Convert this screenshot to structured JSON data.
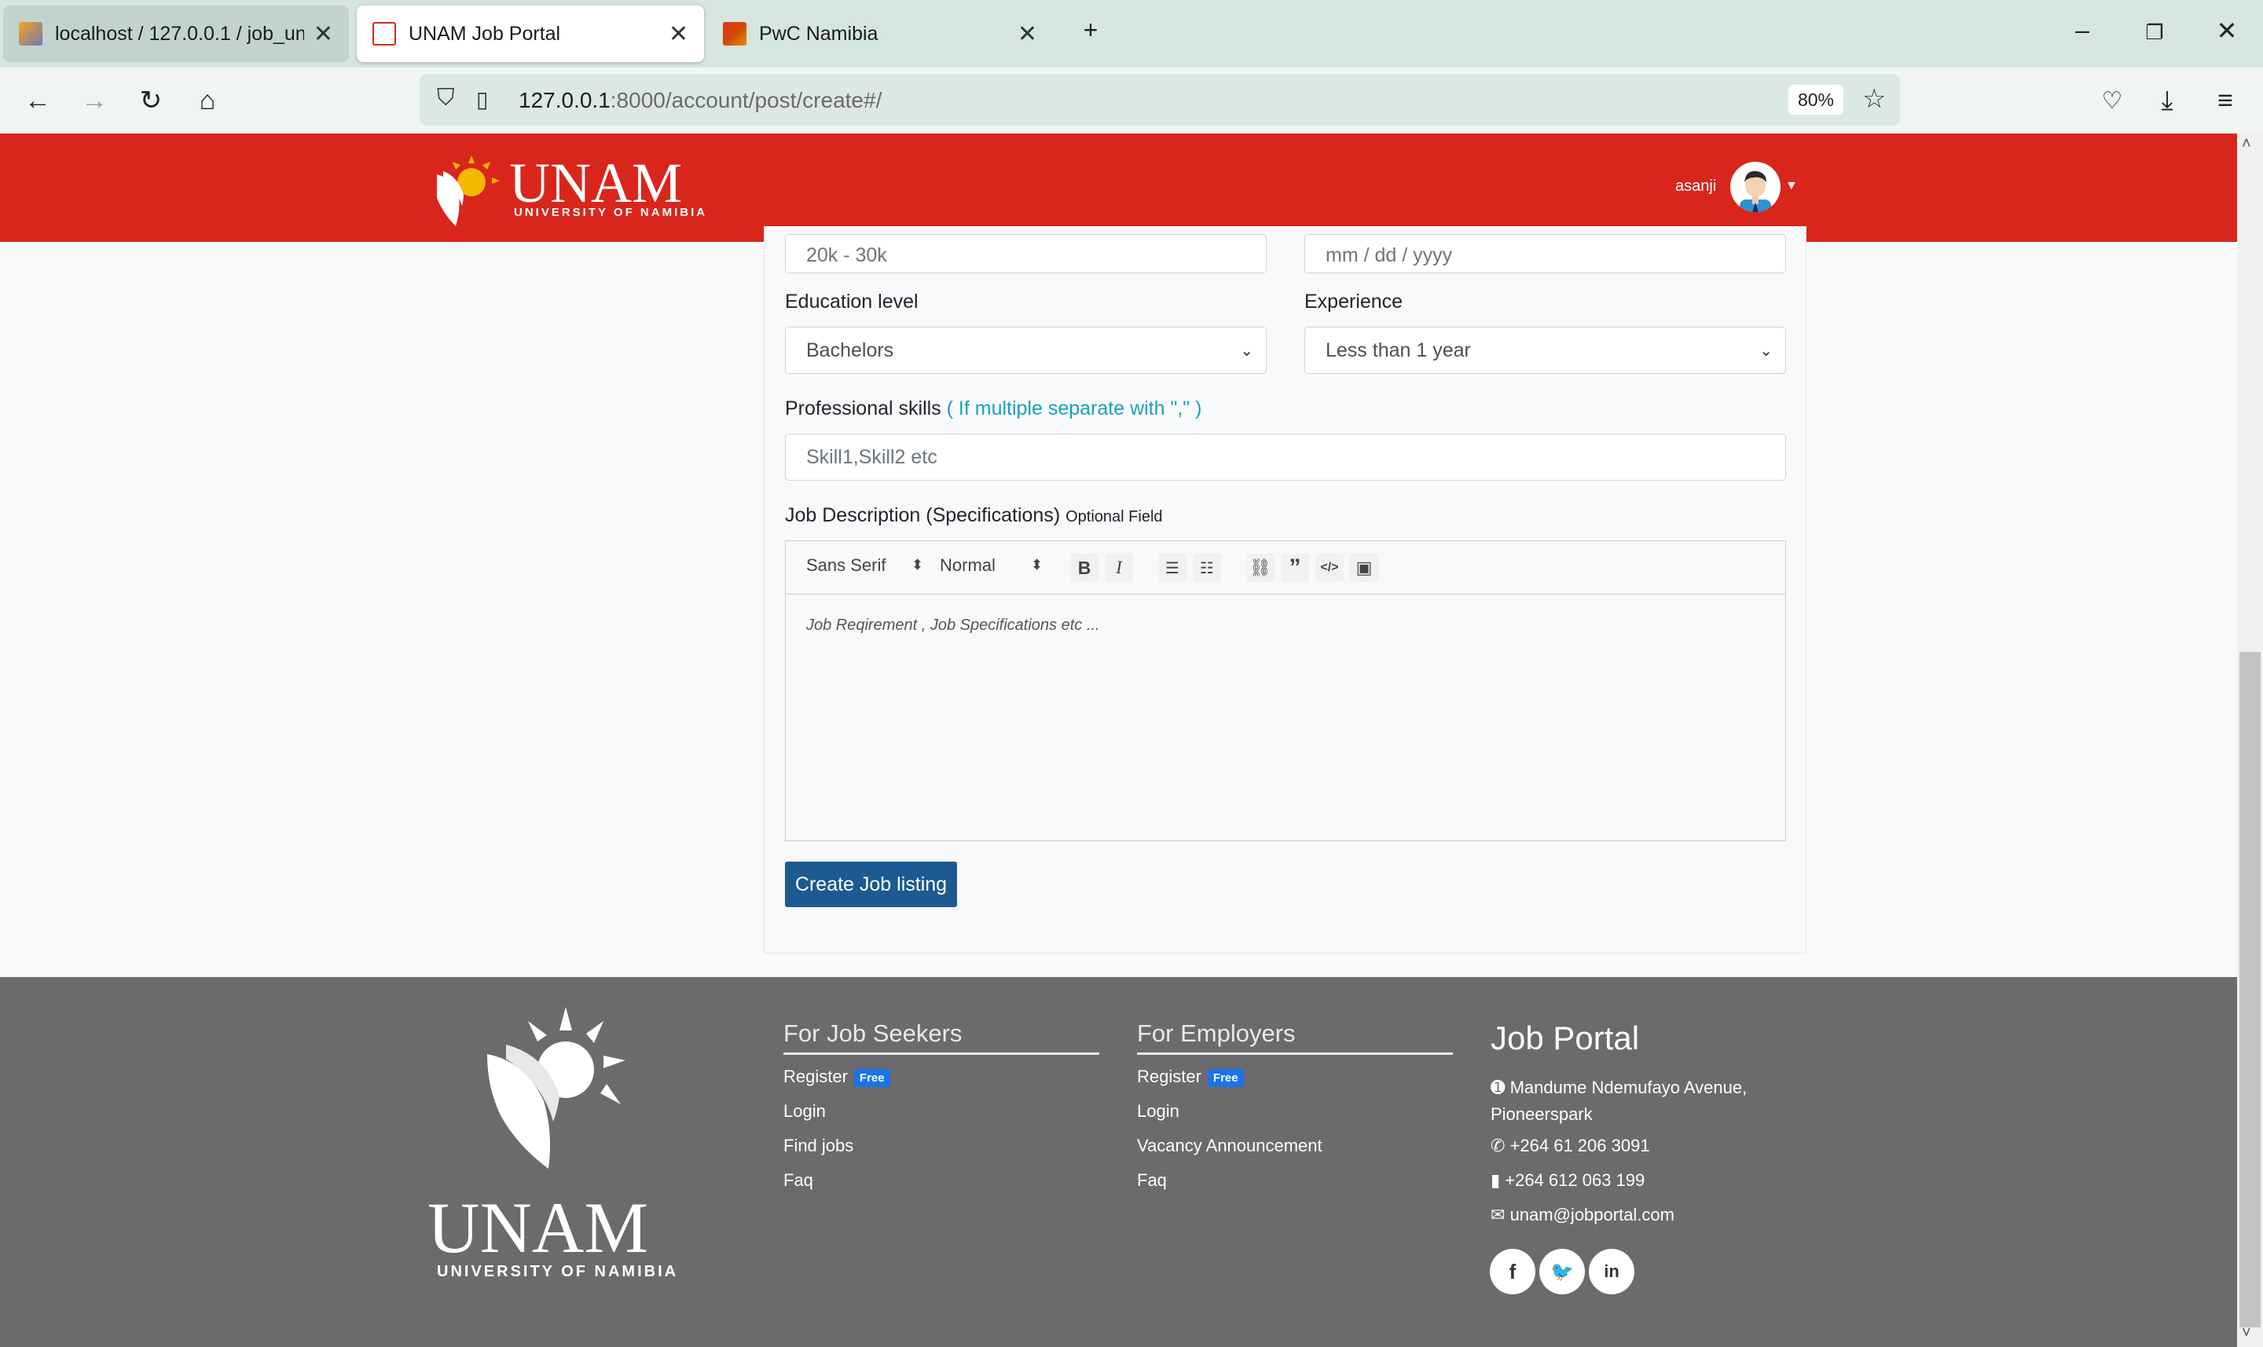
{
  "browser": {
    "tabs": [
      {
        "title": "localhost / 127.0.0.1 / job_unam",
        "active": false
      },
      {
        "title": "UNAM Job Portal",
        "active": true
      },
      {
        "title": "PwC Namibia",
        "active": false
      }
    ],
    "url_host": "127.0.0.1",
    "url_path": ":8000/account/post/create#/",
    "zoom": "80%"
  },
  "header": {
    "logo_title": "UNAM",
    "logo_subtitle": "UNIVERSITY OF NAMIBIA",
    "username": "asanji"
  },
  "form": {
    "salary_value": "20k - 30k",
    "date_placeholder": "mm / dd / yyyy",
    "education_label": "Education level",
    "education_value": "Bachelors",
    "experience_label": "Experience",
    "experience_value": "Less than 1 year",
    "skills_label": "Professional skills",
    "skills_hint": "( If multiple separate with \",\" )",
    "skills_placeholder": "Skill1,Skill2 etc",
    "description_label": "Job Description (Specifications)",
    "description_optional": "Optional Field",
    "editor": {
      "font": "Sans Serif",
      "size": "Normal",
      "placeholder": "Job Reqirement , Job Specifications etc ..."
    },
    "submit_label": "Create Job listing"
  },
  "footer": {
    "logo_title": "UNAM",
    "logo_subtitle": "UNIVERSITY OF NAMIBIA",
    "seekers": {
      "heading": "For Job Seekers",
      "links": [
        "Register",
        "Login",
        "Find jobs",
        "Faq"
      ],
      "badge": "Free"
    },
    "employers": {
      "heading": "For Employers",
      "links": [
        "Register",
        "Login",
        "Vacancy Announcement",
        "Faq"
      ],
      "badge": "Free"
    },
    "portal": {
      "heading": "Job Portal",
      "address_line1": "Mandume Ndemufayo Avenue,",
      "address_line2": "Pioneerspark",
      "phone": "+264 61 206 3091",
      "mobile": "+264 612 063 199",
      "email": "unam@jobportal.com"
    }
  }
}
